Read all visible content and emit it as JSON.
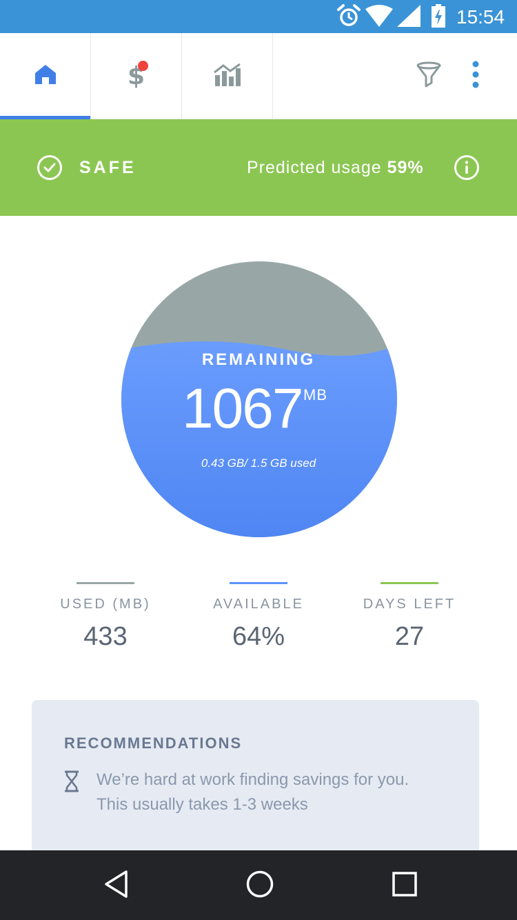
{
  "status_bar": {
    "time": "15:54",
    "icons": [
      "alarm-icon",
      "wifi-icon",
      "signal-icon",
      "battery-charging-icon"
    ],
    "background": "#3a93d6"
  },
  "tabs": [
    {
      "icon": "home-icon",
      "active": true
    },
    {
      "icon": "dollar-icon",
      "active": false,
      "has_badge": true
    },
    {
      "icon": "chart-icon",
      "active": false
    }
  ],
  "toolbar": {
    "filter_icon": "filter-icon",
    "more_icon": "more-vertical-icon"
  },
  "banner": {
    "status": "SAFE",
    "predicted_prefix": "Predicted usage ",
    "predicted_value": "59%",
    "color": "#8bc652"
  },
  "gauge": {
    "label": "REMAINING",
    "value": "1067",
    "unit": "MB",
    "usage": "0.43 GB/ 1.5 GB used",
    "fill_fraction": 0.71,
    "fill_color": "#5b94fb",
    "empty_color": "#98a7a6"
  },
  "stats": [
    {
      "label": "USED (MB)",
      "value": "433",
      "color": "#98a7a6"
    },
    {
      "label": "AVAILABLE",
      "value": "64%",
      "color": "#5b94fb"
    },
    {
      "label": "DAYS LEFT",
      "value": "27",
      "color": "#8bc652"
    }
  ],
  "recommendations": {
    "title": "RECOMMENDATIONS",
    "line1": "We’re hard at work finding savings for you.",
    "line2": "This usually takes 1-3 weeks"
  },
  "nav": {
    "back_icon": "back-icon",
    "home_icon": "home-circle-icon",
    "recent_icon": "recent-apps-icon"
  }
}
